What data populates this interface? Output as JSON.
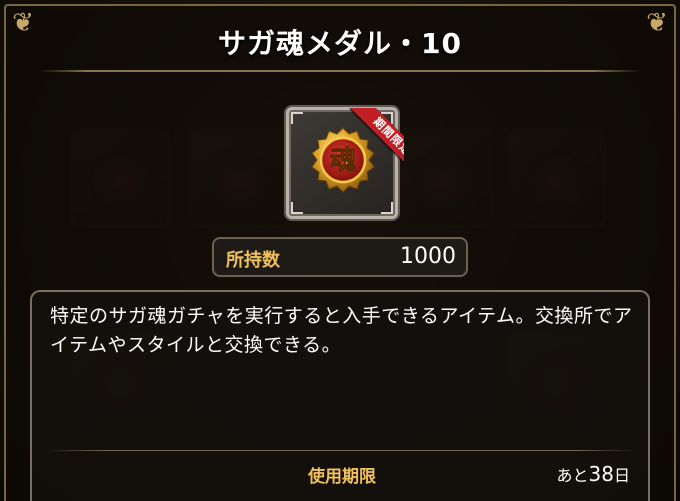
{
  "item": {
    "title": "サガ魂メダル・10",
    "medal_glyph": "魂",
    "badge": "期間限定",
    "icon": "soul-medal-icon"
  },
  "owned": {
    "label": "所持数",
    "value": "1000"
  },
  "description": "特定のサガ魂ガチャを実行すると入手できるアイテム。交換所でアイテムやスタイルと交換できる。",
  "expiry": {
    "label": "使用期限",
    "prefix": "あと",
    "days": "38",
    "suffix": "日"
  },
  "colors": {
    "accent_gold": "#f1c15b",
    "badge_red": "#c21f25",
    "frame_gold": "#7a6542"
  }
}
